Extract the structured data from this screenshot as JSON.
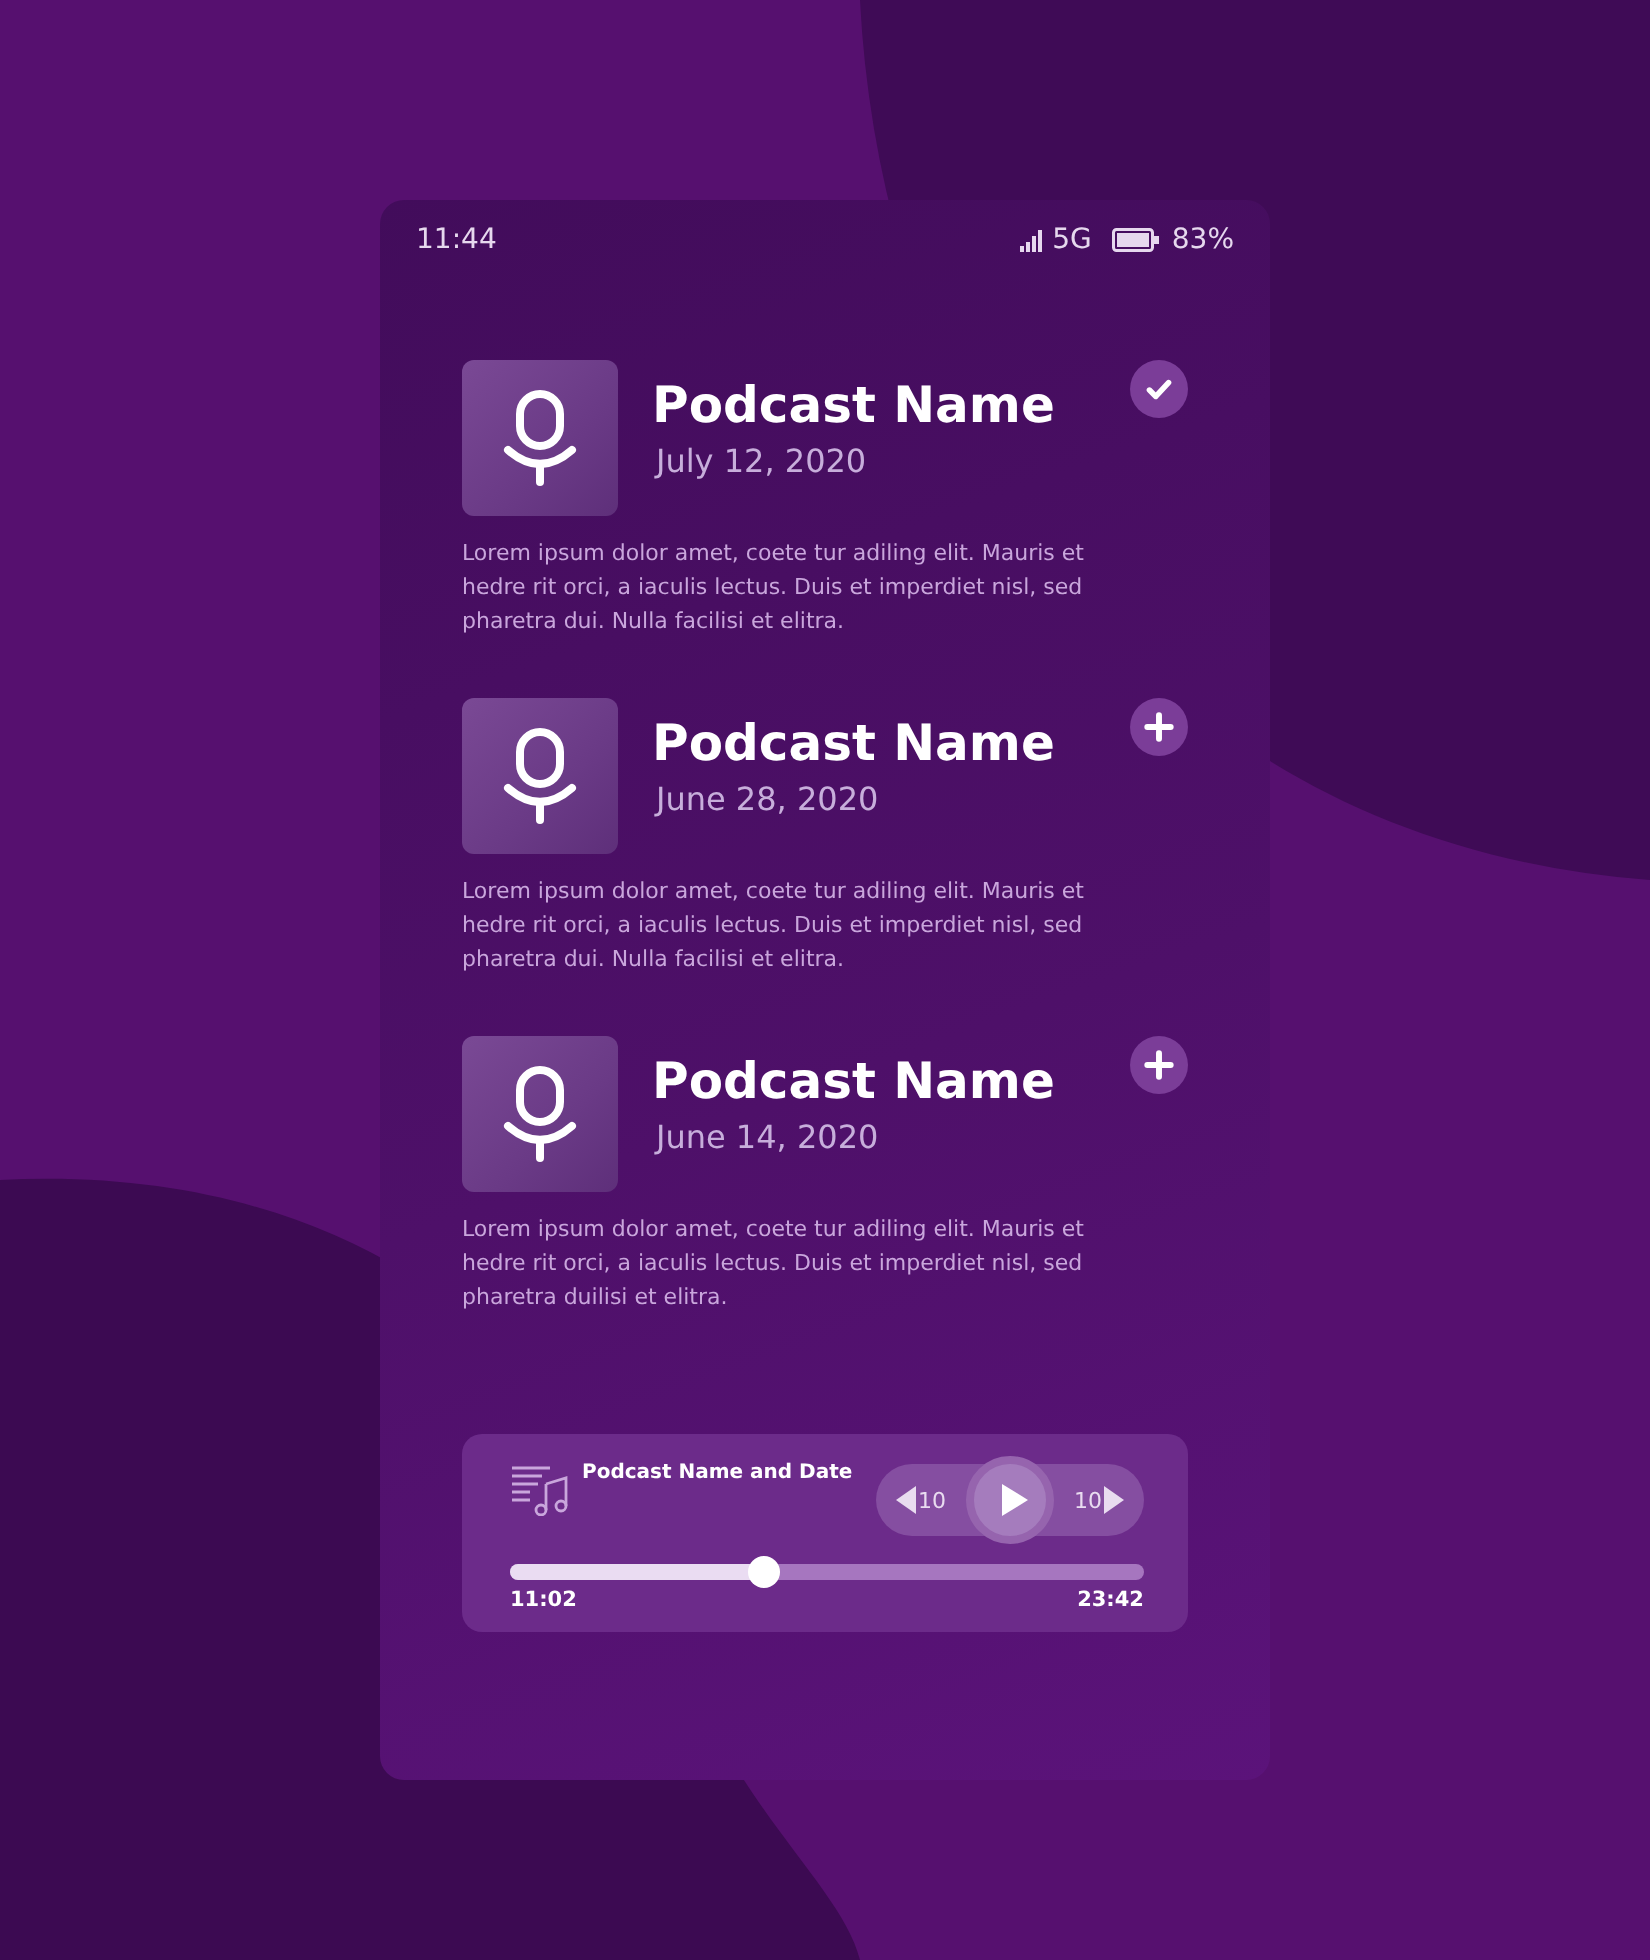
{
  "status_bar": {
    "time": "11:44",
    "network": "5G",
    "battery": "83%"
  },
  "episodes": [
    {
      "title": "Podcast Name",
      "date": "July 12, 2020",
      "description": "Lorem ipsum dolor amet, coete tur adiling elit. Mauris et hedre rit orci, a iaculis lectus. Duis et imperdiet nisl, sed pharetra dui. Nulla facilisi et elitra.",
      "added": true
    },
    {
      "title": "Podcast Name",
      "date": "June 28, 2020",
      "description": "Lorem ipsum dolor amet, coete tur adiling elit. Mauris et hedre rit orci, a iaculis lectus. Duis et imperdiet nisl, sed pharetra dui. Nulla facilisi et elitra.",
      "added": false
    },
    {
      "title": "Podcast Name",
      "date": "June 14, 2020",
      "description": "Lorem ipsum dolor amet, coete tur adiling elit. Mauris et hedre rit orci, a iaculis lectus. Duis et imperdiet nisl, sed pharetra duilisi et elitra.",
      "added": false
    }
  ],
  "player": {
    "title": "Podcast Name and Date",
    "rewind": "10",
    "forward": "10",
    "level": 0.4,
    "elapsed": "11:02",
    "total": "23:42"
  }
}
